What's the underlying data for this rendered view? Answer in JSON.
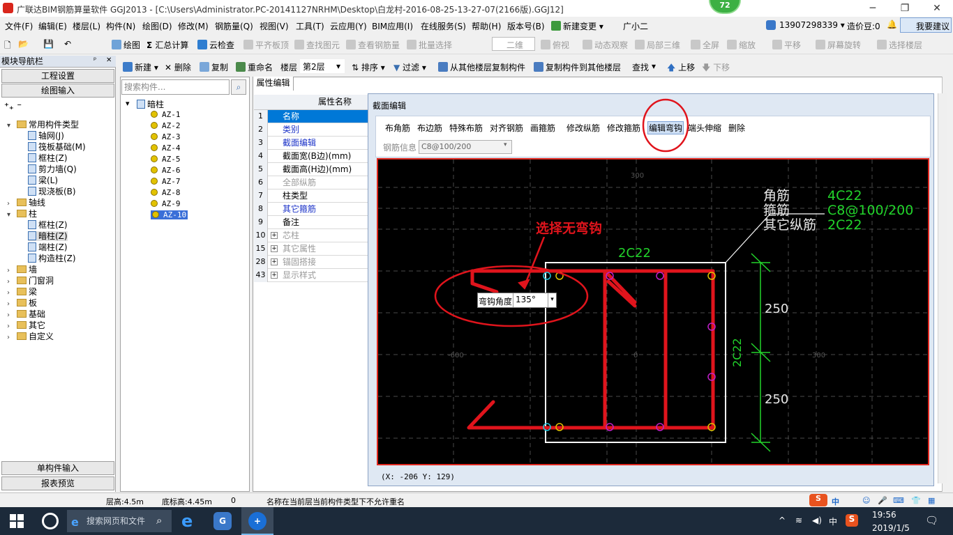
{
  "window": {
    "title": "广联达BIM钢筋算量软件 GGJ2013 - [C:\\Users\\Administrator.PC-20141127NRHM\\Desktop\\白龙村-2016-08-25-13-27-07(2166版).GGJ12]",
    "badge": "72",
    "min": "─",
    "restore": "❐",
    "close": "✕"
  },
  "menu": [
    "文件(F)",
    "编辑(E)",
    "楼层(L)",
    "构件(N)",
    "绘图(D)",
    "修改(M)",
    "钢筋量(Q)",
    "视图(V)",
    "工具(T)",
    "云应用(Y)",
    "BIM应用(I)",
    "在线服务(S)",
    "帮助(H)",
    "版本号(B)",
    "新建变更 ▾",
    "广小二"
  ],
  "account": {
    "phone": "13907298339 ▾",
    "bean": "造价豆:0",
    "suggest": "我要建议"
  },
  "toolbar1": {
    "draw": "绘图",
    "sum": "汇总计算",
    "cloud_check": "云检查",
    "flat_top": "平齐板顶",
    "find_elem": "查找图元",
    "view_rebar": "查看钢筋量",
    "batch": "批量选择",
    "view_mode": "二维",
    "top_view": "俯视",
    "dynamic": "动态观察",
    "local3d": "局部三维",
    "fullscreen": "全屏",
    "zoom": "缩放",
    "pan": "平移",
    "rotate": "屏幕旋转",
    "select_floor": "选择楼层"
  },
  "toolbar2": {
    "new": "新建",
    "delete": "删除",
    "copy": "复制",
    "rename": "重命名",
    "floor_label": "楼层",
    "floor_value": "第2层",
    "sort": "排序",
    "filter": "过滤",
    "copy_from": "从其他楼层复制构件",
    "copy_to": "复制构件到其他楼层",
    "find": "查找",
    "up": "上移",
    "down": "下移"
  },
  "nav": {
    "title": "模块导航栏",
    "pin": "ᵖ",
    "close": "✕",
    "btn_project": "工程设置",
    "btn_draw": "绘图输入",
    "btn_single": "单构件输入",
    "btn_report": "报表预览",
    "tree": [
      {
        "label": "常用构件类型",
        "level": 0,
        "type": "folder",
        "exp": "▾"
      },
      {
        "label": "轴网(J)",
        "level": 1,
        "type": "item"
      },
      {
        "label": "筏板基础(M)",
        "level": 1,
        "type": "item"
      },
      {
        "label": "框柱(Z)",
        "level": 1,
        "type": "item"
      },
      {
        "label": "剪力墙(Q)",
        "level": 1,
        "type": "item"
      },
      {
        "label": "梁(L)",
        "level": 1,
        "type": "item"
      },
      {
        "label": "现浇板(B)",
        "level": 1,
        "type": "item"
      },
      {
        "label": "轴线",
        "level": 0,
        "type": "folder",
        "exp": "›"
      },
      {
        "label": "柱",
        "level": 0,
        "type": "folder",
        "exp": "▾"
      },
      {
        "label": "框柱(Z)",
        "level": 1,
        "type": "item"
      },
      {
        "label": "暗柱(Z)",
        "level": 1,
        "type": "item",
        "selected": true
      },
      {
        "label": "端柱(Z)",
        "level": 1,
        "type": "item"
      },
      {
        "label": "构造柱(Z)",
        "level": 1,
        "type": "item"
      },
      {
        "label": "墙",
        "level": 0,
        "type": "folder",
        "exp": "›"
      },
      {
        "label": "门窗洞",
        "level": 0,
        "type": "folder",
        "exp": "›"
      },
      {
        "label": "梁",
        "level": 0,
        "type": "folder",
        "exp": "›"
      },
      {
        "label": "板",
        "level": 0,
        "type": "folder",
        "exp": "›"
      },
      {
        "label": "基础",
        "level": 0,
        "type": "folder",
        "exp": "›"
      },
      {
        "label": "其它",
        "level": 0,
        "type": "folder",
        "exp": "›"
      },
      {
        "label": "自定义",
        "level": 0,
        "type": "folder",
        "exp": "›"
      }
    ]
  },
  "components": {
    "search_placeholder": "搜索构件...",
    "root": "暗柱",
    "exp": "▾",
    "items": [
      "AZ-1",
      "AZ-2",
      "AZ-3",
      "AZ-4",
      "AZ-5",
      "AZ-6",
      "AZ-7",
      "AZ-8",
      "AZ-9",
      "AZ-10"
    ],
    "selected": "AZ-10"
  },
  "props": {
    "tab": "属性编辑",
    "header": "属性名称",
    "rows": [
      {
        "num": "1",
        "label": "名称",
        "style": "hl"
      },
      {
        "num": "2",
        "label": "类别",
        "style": "blue"
      },
      {
        "num": "3",
        "label": "截面编辑",
        "style": "blue"
      },
      {
        "num": "4",
        "label": "截面宽(B边)(mm)",
        "style": "normal"
      },
      {
        "num": "5",
        "label": "截面高(H边)(mm)",
        "style": "normal"
      },
      {
        "num": "6",
        "label": "全部纵筋",
        "style": "gray"
      },
      {
        "num": "7",
        "label": "柱类型",
        "style": "normal"
      },
      {
        "num": "8",
        "label": "其它箍筋",
        "style": "blue"
      },
      {
        "num": "9",
        "label": "备注",
        "style": "normal"
      },
      {
        "num": "10",
        "label": "芯柱",
        "style": "gray",
        "plus": true
      },
      {
        "num": "15",
        "label": "其它属性",
        "style": "gray",
        "plus": true
      },
      {
        "num": "28",
        "label": "锚固搭接",
        "style": "gray",
        "plus": true
      },
      {
        "num": "43",
        "label": "显示样式",
        "style": "gray",
        "plus": true
      }
    ]
  },
  "section": {
    "title": "截面编辑",
    "tools": [
      "布角筋",
      "布边筋",
      "特殊布筋",
      "对齐钢筋",
      "画箍筋",
      "修改纵筋",
      "修改箍筋",
      "编辑弯钩",
      "端头伸缩",
      "删除"
    ],
    "active_tool": "编辑弯钩",
    "rebar_info_label": "钢筋信息",
    "rebar_info_value": "C8@100/200",
    "coords": "(X: -206 Y: 129)",
    "legend": [
      {
        "label": "角筋",
        "value": "4C22"
      },
      {
        "label": "箍筋",
        "value": "C8@100/200"
      },
      {
        "label": "其它纵筋",
        "value": "2C22"
      }
    ],
    "top_label": "2C22",
    "side_label": "2C22",
    "dim1": "250",
    "dim2": "250",
    "grid_labels": [
      "300",
      "-600",
      "0",
      "300"
    ],
    "hook_label": "弯钩角度",
    "hook_value": "135°",
    "annotation": "选择无弯钩",
    "colors": {
      "rebar": "#e0141c",
      "outline": "#ffffff",
      "dim": "#22d42b",
      "annot": "#e0141c"
    }
  },
  "status": {
    "floor_h": "层高:4.5m",
    "base_h": "底标高:4.45m",
    "zero": "0",
    "msg": "名称在当前层当前构件类型下不允许重名"
  },
  "taskbar": {
    "search": "搜索网页和文件",
    "time": "19:56",
    "date": "2019/1/5",
    "ime": "中",
    "ime2": "中"
  }
}
